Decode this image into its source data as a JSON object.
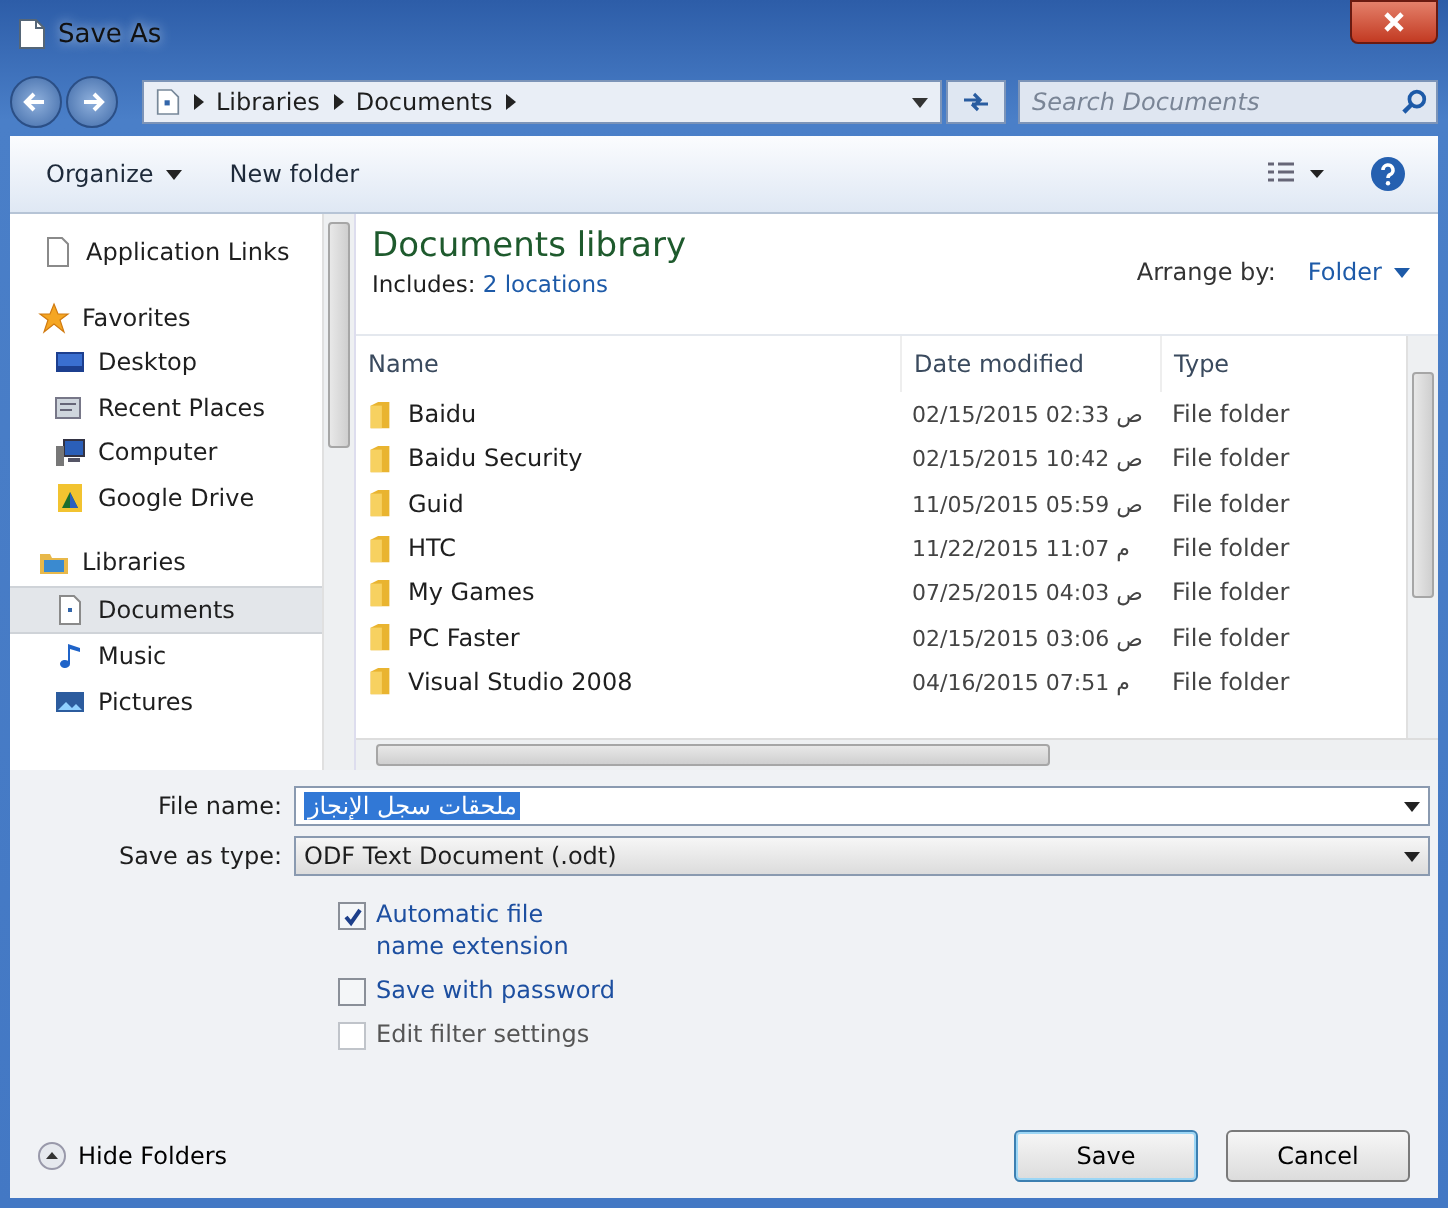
{
  "window": {
    "title": "Save As"
  },
  "address_bar": {
    "path": [
      "Libraries",
      "Documents"
    ]
  },
  "search": {
    "placeholder": "Search Documents"
  },
  "toolbar": {
    "organize": "Organize",
    "new_folder": "New folder"
  },
  "sidebar": {
    "items": [
      {
        "label": "Application Links",
        "kind": "item",
        "selected": false
      },
      {
        "label": "Favorites",
        "kind": "heading",
        "selected": false
      },
      {
        "label": "Desktop",
        "kind": "item",
        "selected": false
      },
      {
        "label": "Recent Places",
        "kind": "item",
        "selected": false
      },
      {
        "label": "Computer",
        "kind": "item",
        "selected": false
      },
      {
        "label": "Google Drive",
        "kind": "item",
        "selected": false
      },
      {
        "label": "Libraries",
        "kind": "heading",
        "selected": false
      },
      {
        "label": "Documents",
        "kind": "item",
        "selected": true
      },
      {
        "label": "Music",
        "kind": "item",
        "selected": false
      },
      {
        "label": "Pictures",
        "kind": "item",
        "selected": false
      }
    ]
  },
  "library": {
    "title": "Documents library",
    "includes_label": "Includes:",
    "locations_link": "2 locations",
    "arrange_label": "Arrange by:",
    "arrange_value": "Folder"
  },
  "table": {
    "columns": [
      "Name",
      "Date modified",
      "Type"
    ],
    "rows": [
      {
        "name": "Baidu",
        "date": "02/15/2015 02:33 ص",
        "type": "File folder"
      },
      {
        "name": "Baidu Security",
        "date": "02/15/2015 10:42 ص",
        "type": "File folder"
      },
      {
        "name": "Guid",
        "date": "11/05/2015 05:59 ص",
        "type": "File folder"
      },
      {
        "name": "HTC",
        "date": "11/22/2015 11:07 م",
        "type": "File folder"
      },
      {
        "name": "My Games",
        "date": "07/25/2015 04:03 ص",
        "type": "File folder"
      },
      {
        "name": "PC Faster",
        "date": "02/15/2015 03:06 ص",
        "type": "File folder"
      },
      {
        "name": "Visual Studio 2008",
        "date": "04/16/2015 07:51 م",
        "type": "File folder"
      }
    ]
  },
  "file_name": {
    "label": "File name:",
    "value": "ملحقات سجل الإنجاز"
  },
  "save_as_type": {
    "label": "Save as type:",
    "value": "ODF Text Document (.odt)"
  },
  "options": [
    {
      "label": "Automatic file name extension",
      "checked": true,
      "disabled": false
    },
    {
      "label": "Save with password",
      "checked": false,
      "disabled": false
    },
    {
      "label": "Edit filter settings",
      "checked": false,
      "disabled": true
    }
  ],
  "hide_folders": "Hide Folders",
  "buttons": {
    "save": "Save",
    "cancel": "Cancel"
  }
}
